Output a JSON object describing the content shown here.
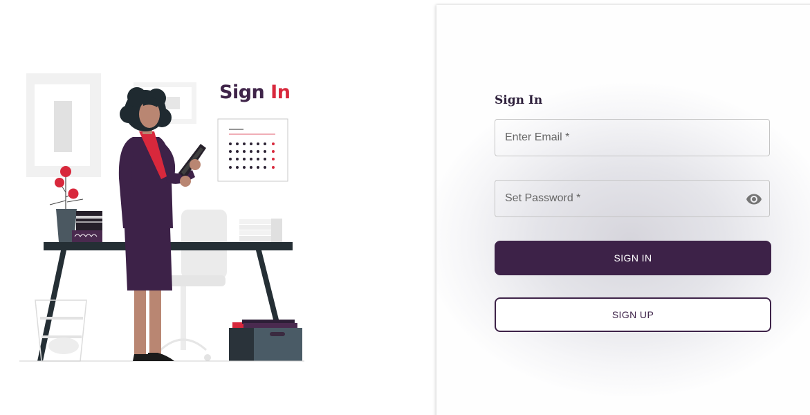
{
  "illustration": {
    "title_part1": "Sign",
    "title_part2": "In"
  },
  "form": {
    "title": "Sign In",
    "email": {
      "placeholder": "Enter Email *"
    },
    "password": {
      "placeholder": "Set Password *",
      "toggle_icon": "eye-icon"
    },
    "signin_label": "SIGN IN",
    "signup_label": "SIGN UP"
  },
  "colors": {
    "brand_purple": "#3d2248",
    "accent_red": "#d8283c"
  }
}
